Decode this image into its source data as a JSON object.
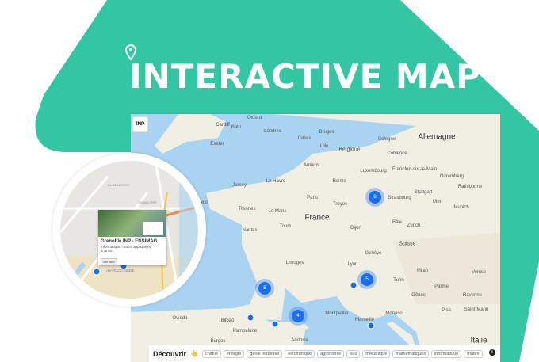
{
  "title": "INTERACTIVE MAP",
  "colors": {
    "brand": "#33c6a2",
    "marker": "#1a6ff0",
    "sea": "#a9d3f0",
    "land": "#f1eee4"
  },
  "map": {
    "logo": "INP",
    "country_labels": [
      "France",
      "Allemagne",
      "Belgique",
      "Suisse",
      "Italie",
      "Luxembourg",
      "Monaco",
      "Saint-Marin",
      "Andorre",
      "Jersey"
    ],
    "city_labels": [
      "Londres",
      "Oxford",
      "Cardiff",
      "Bath",
      "Exeter",
      "Calais",
      "Bruges",
      "Lille",
      "Amiens",
      "Le Havre",
      "Paris",
      "Reims",
      "Troyes",
      "Rennes",
      "Brest",
      "Le Mans",
      "Nantes",
      "Tours",
      "Limoges",
      "Dijon",
      "Lyon",
      "Genève",
      "Turin",
      "Milan",
      "Gênes",
      "Parme",
      "Marseille",
      "Montpellier",
      "Bilbao",
      "Oviedo",
      "Pampelune",
      "Burgos",
      "Strasbourg",
      "Stuttgart",
      "Francfort-sur-le-Main",
      "Cologne",
      "Coblence",
      "Nuremberg",
      "Ratisbonne",
      "Munich",
      "Ulm",
      "Zurich",
      "Bâle",
      "Venise",
      "Ravenne",
      "Pise"
    ],
    "clusters": [
      {
        "count": "8"
      },
      {
        "count": "5"
      },
      {
        "count": "5"
      },
      {
        "count": "4"
      }
    ],
    "single_markers": 4
  },
  "discover": {
    "label": "Découvrir",
    "hand_icon": "👆",
    "tags": [
      "chimie",
      "énergie",
      "génie industriel",
      "électronique",
      "agronomie",
      "eau",
      "mécanique",
      "mathématiques",
      "informatique",
      "matéri"
    ],
    "info_icon": "i"
  },
  "popup": {
    "title": "Grenoble INP - ENSIMAG",
    "description": "Informatique, maths appliqué et finance.",
    "button": "site web",
    "street_labels": [
      "LA BEAUVERT",
      "GRAND PRÉ",
      "UNIVERSITAIRE"
    ]
  }
}
